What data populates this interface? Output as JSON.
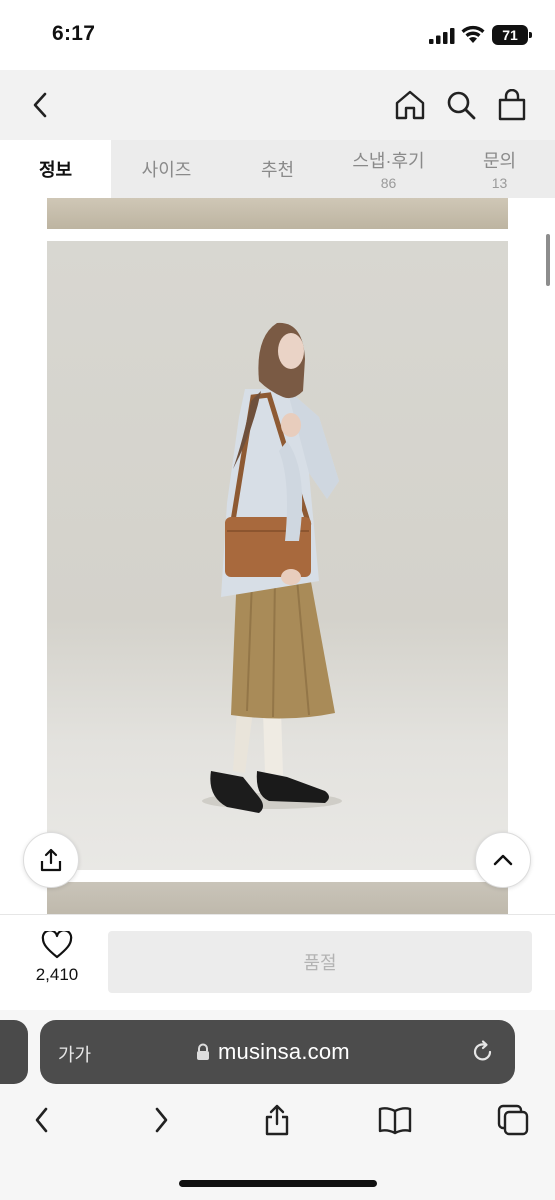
{
  "status": {
    "time": "6:17",
    "battery": "71"
  },
  "header": {
    "back_icon": "chevron-left-icon",
    "home_icon": "home-icon",
    "search_icon": "search-icon",
    "cart_icon": "shopping-bag-icon"
  },
  "tabs": [
    {
      "label": "정보",
      "count": "",
      "active": true
    },
    {
      "label": "사이즈",
      "count": ""
    },
    {
      "label": "추천",
      "count": ""
    },
    {
      "label": "스냅·후기",
      "count": "86"
    },
    {
      "label": "문의",
      "count": "13"
    }
  ],
  "content": {
    "share_icon": "share-icon",
    "scroll_top_icon": "chevron-up-icon"
  },
  "action_bar": {
    "like_count": "2,410",
    "soldout_label": "품절"
  },
  "safari": {
    "text_size_label": "가가",
    "url": "musinsa.com"
  },
  "colors": {
    "tab_active_bg": "#ffffff",
    "tab_inactive_bg": "#ececec",
    "soldout_bg": "#ececec",
    "address_bar_bg": "#4c4c4c"
  }
}
